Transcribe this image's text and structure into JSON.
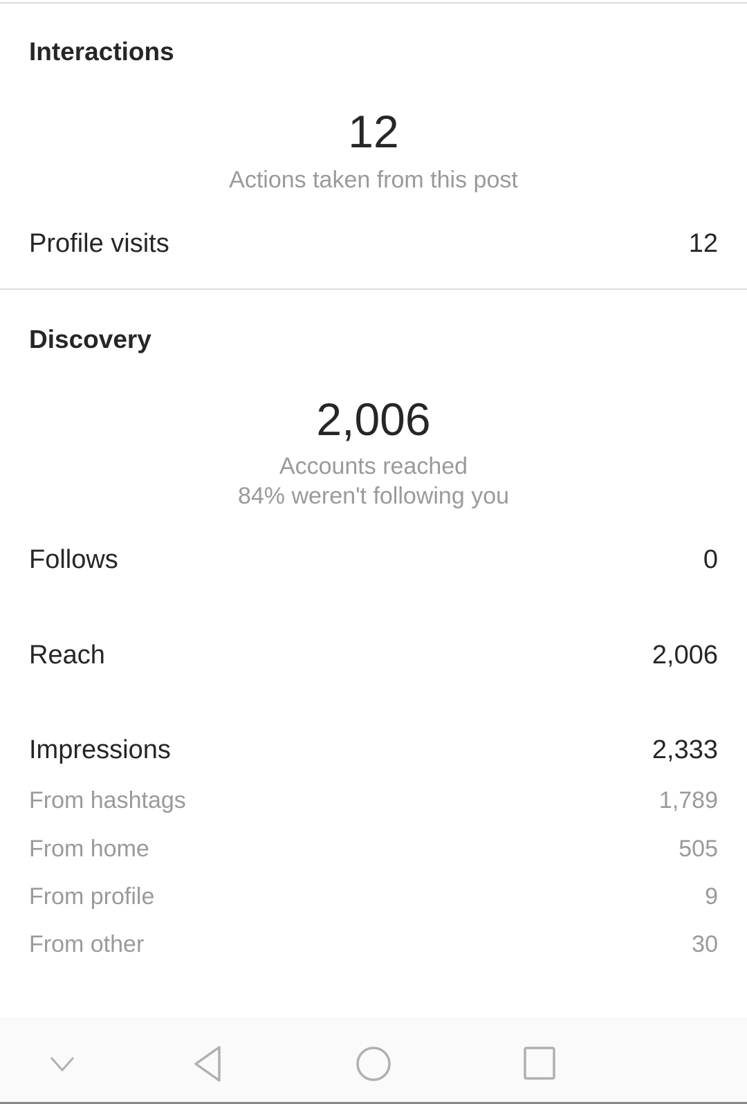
{
  "interactions": {
    "title": "Interactions",
    "total": "12",
    "total_label": "Actions taken from this post",
    "rows": [
      {
        "label": "Profile visits",
        "value": "12"
      }
    ]
  },
  "discovery": {
    "title": "Discovery",
    "total": "2,006",
    "total_label": "Accounts reached",
    "total_sublabel": "84% weren't following you",
    "rows": [
      {
        "label": "Follows",
        "value": "0"
      },
      {
        "label": "Reach",
        "value": "2,006"
      },
      {
        "label": "Impressions",
        "value": "2,333"
      }
    ],
    "impression_sources": [
      {
        "label": "From hashtags",
        "value": "1,789"
      },
      {
        "label": "From home",
        "value": "505"
      },
      {
        "label": "From profile",
        "value": "9"
      },
      {
        "label": "From other",
        "value": "30"
      }
    ]
  },
  "navbar": {
    "icons": [
      "chevron-down-icon",
      "back-icon",
      "home-icon",
      "recents-icon"
    ],
    "icon_color": "#b0b0b0"
  }
}
